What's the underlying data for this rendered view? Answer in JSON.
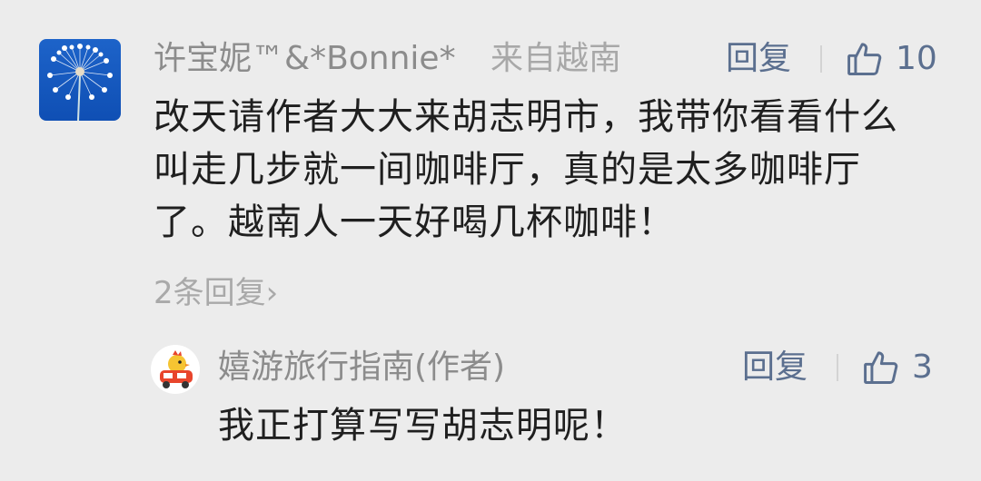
{
  "comment": {
    "author": "许宝妮™&*Bonnie*",
    "region": "来自越南",
    "reply_label": "回复",
    "like_count": "10",
    "text": "改天请作者大大来胡志明市，我带你看看什么叫走几步就一间咖啡厅，真的是太多咖啡厅了。越南人一天好喝几杯咖啡！",
    "replies_link": "2条回复"
  },
  "author_reply": {
    "author": "嬉游旅行指南(作者)",
    "reply_label": "回复",
    "like_count": "3",
    "text": "我正打算写写胡志明呢！"
  },
  "icons": {
    "like": "thumbs-up-icon",
    "chevron": "chevron-right-icon"
  },
  "colors": {
    "background": "#ececec",
    "name": "#8c8c8c",
    "action": "#5b6f8f",
    "body_text": "#1f1f1f",
    "muted": "#a9a9a9"
  }
}
